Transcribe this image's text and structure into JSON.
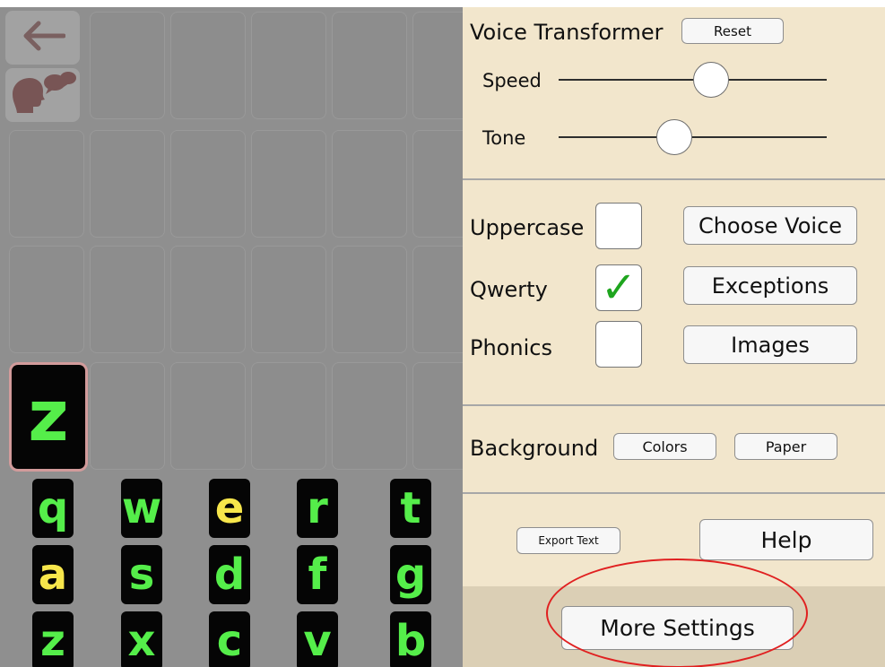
{
  "colors": {
    "grid_bg": "#8f8f8f",
    "panel_bg": "#f2e6cc",
    "bottom_bar_bg": "#dbcfb5",
    "key_bg": "#050505",
    "key_green": "#55ee4a",
    "key_yellow": "#f7e64b",
    "selected_border": "#d29b9b",
    "check_green": "#1ea51e",
    "highlight": "#e02020"
  },
  "toolbar": {
    "back_icon": "left-arrow-icon",
    "speak_icon": "speaking-head-icon"
  },
  "selected_tile": {
    "letter": "z"
  },
  "keyboard": {
    "rows": [
      [
        {
          "letter": "q",
          "color": "green"
        },
        {
          "letter": "w",
          "color": "green"
        },
        {
          "letter": "e",
          "color": "yellow"
        },
        {
          "letter": "r",
          "color": "green"
        },
        {
          "letter": "t",
          "color": "green"
        }
      ],
      [
        {
          "letter": "a",
          "color": "yellow"
        },
        {
          "letter": "s",
          "color": "green"
        },
        {
          "letter": "d",
          "color": "green"
        },
        {
          "letter": "f",
          "color": "green"
        },
        {
          "letter": "g",
          "color": "green"
        }
      ],
      [
        {
          "letter": "z",
          "color": "green"
        },
        {
          "letter": "x",
          "color": "green"
        },
        {
          "letter": "c",
          "color": "green"
        },
        {
          "letter": "v",
          "color": "green"
        },
        {
          "letter": "b",
          "color": "green"
        }
      ]
    ]
  },
  "settings": {
    "voice_transformer": {
      "title": "Voice Transformer",
      "reset_label": "Reset",
      "speed_label": "Speed",
      "speed_value": 0.57,
      "tone_label": "Tone",
      "tone_value": 0.43
    },
    "options": {
      "uppercase_label": "Uppercase",
      "uppercase_checked": false,
      "qwerty_label": "Qwerty",
      "qwerty_checked": true,
      "qwerty_check_glyph": "✓",
      "phonics_label": "Phonics",
      "phonics_checked": false,
      "choose_voice_label": "Choose Voice",
      "exceptions_label": "Exceptions",
      "images_label": "Images"
    },
    "background": {
      "label": "Background",
      "colors_label": "Colors",
      "paper_label": "Paper"
    },
    "misc": {
      "export_text_label": "Export Text",
      "help_label": "Help"
    },
    "more_settings_label": "More Settings"
  }
}
